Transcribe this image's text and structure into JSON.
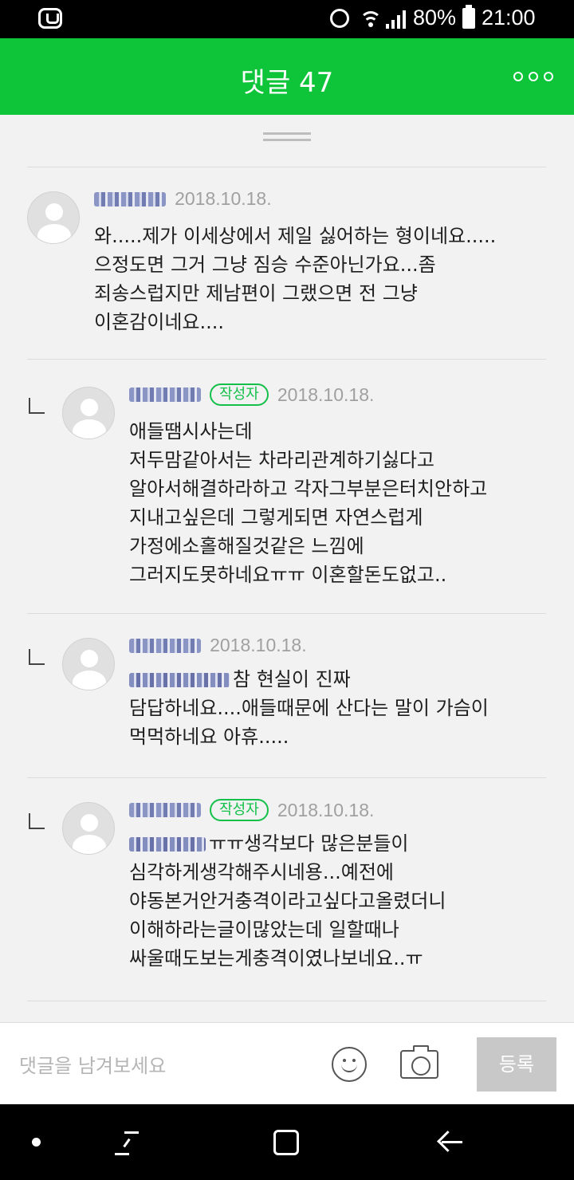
{
  "status_bar": {
    "battery_percent": "80%",
    "time": "21:00"
  },
  "header": {
    "title": "댓글 47",
    "more_icon": "more-icon"
  },
  "comments": [
    {
      "is_reply": false,
      "is_author": false,
      "date": "2018.10.18.",
      "text": "와.....제가 이세상에서 제일 싫어하는 형이네요.....\n으정도면 그거 그냥 짐승 수준아닌가요...좀\n죄송스럽지만 제남편이 그랬으면 전 그냥\n이혼감이네요...."
    },
    {
      "is_reply": true,
      "is_author": true,
      "badge": "작성자",
      "date": "2018.10.18.",
      "text": "애들땜시사는데\n저두맘같아서는 차라리관계하기싫다고\n알아서해결하라하고 각자그부분은터치안하고\n지내고싶은데 그렇게되면 자연스럽게\n가정에소홀해질것같은 느낌에\n그러지도못하네요ㅠㅠ 이혼할돈도없고.."
    },
    {
      "is_reply": true,
      "is_author": false,
      "date": "2018.10.18.",
      "text": "참 현실이 진짜\n담답하네요....애들때문에 산다는 말이 가슴이\n먹먹하네요 아휴....."
    },
    {
      "is_reply": true,
      "is_author": true,
      "badge": "작성자",
      "date": "2018.10.18.",
      "text": "ㅠㅠ생각보다 많은분들이\n심각하게생각해주시네용...예전에\n야동본거안거충격이라고싶다고올렸더니\n이해하라는글이많았는데 일할때나\n싸울때도보는게충격이였나보네요..ㅠ"
    }
  ],
  "input_bar": {
    "placeholder": "댓글을 남겨보세요",
    "submit_label": "등록"
  },
  "colors": {
    "header_green": "#0ec53a",
    "badge_green": "#14c04a"
  }
}
